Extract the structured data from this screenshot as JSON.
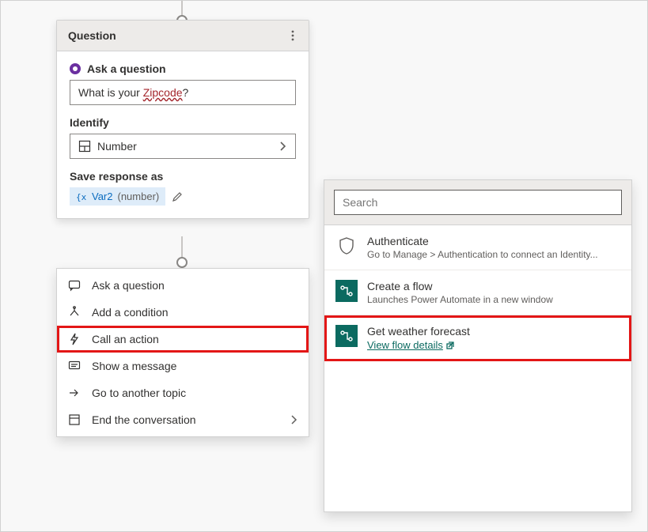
{
  "question_card": {
    "header_title": "Question",
    "ask_label": "Ask a question",
    "question_text_prefix": "What is your ",
    "question_text_red": "Zipcode",
    "question_text_suffix": "?",
    "identify_label": "Identify",
    "identify_value": "Number",
    "save_label": "Save response as",
    "chip_var": "Var2",
    "chip_type": "(number)"
  },
  "context_menu": {
    "items": [
      {
        "label": "Ask a question",
        "icon": "chat"
      },
      {
        "label": "Add a condition",
        "icon": "branch"
      },
      {
        "label": "Call an action",
        "icon": "bolt",
        "highlight": true
      },
      {
        "label": "Show a message",
        "icon": "message"
      },
      {
        "label": "Go to another topic",
        "icon": "redirect"
      },
      {
        "label": "End the conversation",
        "icon": "end",
        "chevron": true
      }
    ]
  },
  "right_panel": {
    "search_placeholder": "Search",
    "actions": [
      {
        "icon": "shield",
        "title": "Authenticate",
        "sub": "Go to Manage > Authentication to connect an Identity..."
      },
      {
        "icon": "flow",
        "title": "Create a flow",
        "sub": "Launches Power Automate in a new window"
      },
      {
        "icon": "flow",
        "title": "Get weather forecast",
        "link": "View flow details",
        "highlight": true
      }
    ]
  }
}
